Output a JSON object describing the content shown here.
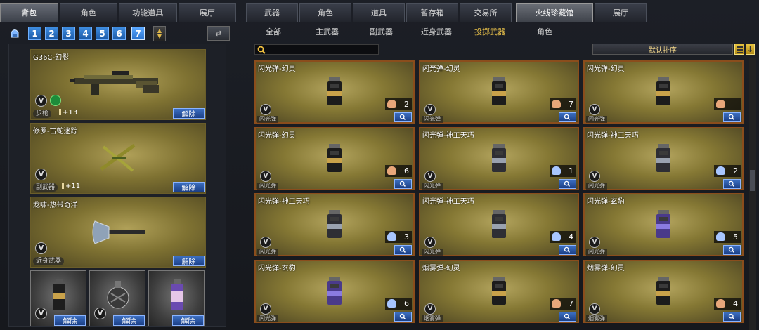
{
  "left": {
    "tabs": [
      "背包",
      "角色",
      "功能道具",
      "展厅"
    ],
    "active_tab": 0,
    "pages": [
      "1",
      "2",
      "3",
      "4",
      "5",
      "6",
      "7"
    ],
    "active_page": 6,
    "weapons": [
      {
        "name": "G36C-幻影",
        "v_label": "V",
        "tag": "步枪",
        "bonus": "+13",
        "action": "解除"
      },
      {
        "name": "修罗-古蛇迷踪",
        "v_label": "V",
        "tag": "副武器",
        "bonus": "+11",
        "action": "解除"
      },
      {
        "name": "龙啸-热带奇洋",
        "v_label": "V",
        "tag": "近身武器",
        "bonus": "",
        "action": "解除"
      }
    ],
    "grenades": [
      {
        "v_label": "V",
        "action": "解除"
      },
      {
        "v_label": "V",
        "action": "解除"
      },
      {
        "v_label": "",
        "action": "解除"
      }
    ]
  },
  "right": {
    "tabs": [
      "武器",
      "角色",
      "道具",
      "暂存箱",
      "交易所",
      "火线珍藏馆",
      "展厅"
    ],
    "active_tab": 5,
    "subtabs": [
      "全部",
      "主武器",
      "副武器",
      "近身武器",
      "投掷武器",
      "角色"
    ],
    "active_subtab": 4,
    "search_placeholder": "",
    "sort_label": "默认排序",
    "items": [
      {
        "name": "闪光弹-幻灵",
        "tag": "闪光弹",
        "count": "2",
        "v_label": "V",
        "badge_color": "#e8a77a"
      },
      {
        "name": "闪光弹-幻灵",
        "tag": "闪光弹",
        "count": "7",
        "v_label": "V",
        "badge_color": "#e8a77a"
      },
      {
        "name": "闪光弹-幻灵",
        "tag": "闪光弹",
        "count": "",
        "v_label": "V",
        "badge_color": "#e8a77a"
      },
      {
        "name": "闪光弹-幻灵",
        "tag": "闪光弹",
        "count": "6",
        "v_label": "V",
        "badge_color": "#e8a77a"
      },
      {
        "name": "闪光弹-神工天巧",
        "tag": "闪光弹",
        "count": "1",
        "v_label": "V",
        "badge_color": "#a8c6ff"
      },
      {
        "name": "闪光弹-神工天巧",
        "tag": "闪光弹",
        "count": "2",
        "v_label": "V",
        "badge_color": "#a8c6ff"
      },
      {
        "name": "闪光弹-神工天巧",
        "tag": "闪光弹",
        "count": "3",
        "v_label": "V",
        "badge_color": "#a8c6ff"
      },
      {
        "name": "闪光弹-神工天巧",
        "tag": "闪光弹",
        "count": "4",
        "v_label": "V",
        "badge_color": "#a8c6ff"
      },
      {
        "name": "闪光弹-玄豹",
        "tag": "闪光弹",
        "count": "5",
        "v_label": "V",
        "badge_color": "#a8c6ff"
      },
      {
        "name": "闪光弹-玄豹",
        "tag": "闪光弹",
        "count": "6",
        "v_label": "V",
        "badge_color": "#a8c6ff"
      },
      {
        "name": "烟雾弹-幻灵",
        "tag": "烟雾弹",
        "count": "7",
        "v_label": "V",
        "badge_color": "#e8a77a"
      },
      {
        "name": "烟雾弹-幻灵",
        "tag": "烟雾弹",
        "count": "4",
        "v_label": "V",
        "badge_color": "#e8a77a"
      }
    ]
  }
}
